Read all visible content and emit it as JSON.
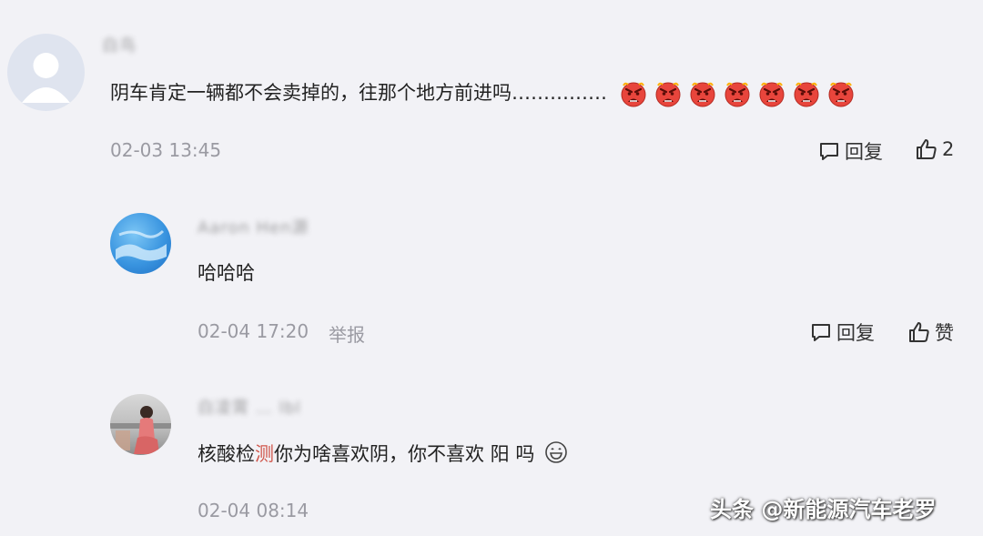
{
  "comments": [
    {
      "username": "白鸟",
      "text": "阴车肯定一辆都不会卖掉的，往那个地方前进吗……………",
      "emoji_icon": "angry-face-icon",
      "emoji_count": 7,
      "time": "02-03 13:45",
      "reply_label": "回复",
      "like_label": "2"
    },
    {
      "username": "Aaron Hen源",
      "text": "哈哈哈",
      "time": "02-04 17:20",
      "report_label": "举报",
      "reply_label": "回复",
      "like_label": "赞"
    },
    {
      "username": "白凌霄 … lbl",
      "text_parts": [
        "核酸检",
        "测",
        "你为啥喜欢阴，你不喜欢 阳 吗"
      ],
      "text_highlight_color": "#d0554a",
      "emoji_icon": "grin-face-icon",
      "time": "02-04 08:14"
    }
  ],
  "watermark": "头条 @新能源汽车老罗",
  "colors": {
    "background": "#f2f2f6",
    "meta": "#9a9aa2",
    "emoji": "#e8453c"
  }
}
